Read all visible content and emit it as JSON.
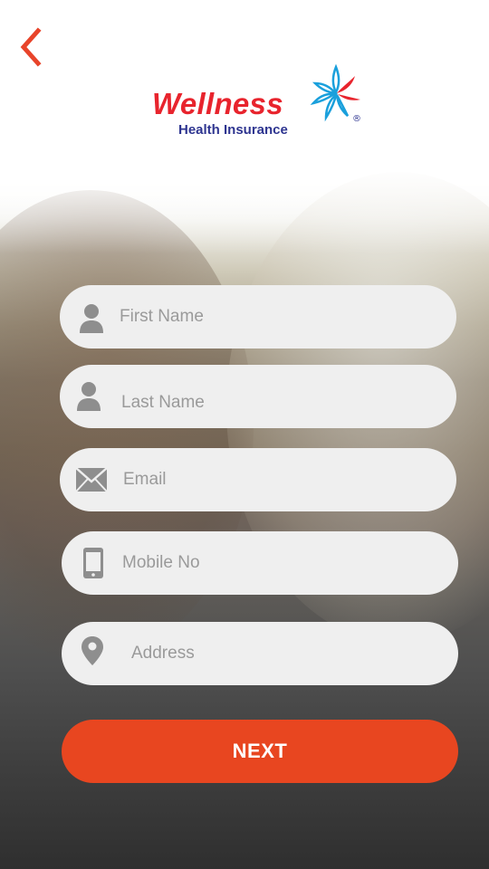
{
  "header": {
    "brand_name": "Wellness",
    "brand_sub": "Health Insurance",
    "registered_mark": "®"
  },
  "form": {
    "first_name": {
      "placeholder": "First Name",
      "value": "",
      "icon": "user-icon"
    },
    "last_name": {
      "placeholder": "Last Name",
      "value": "",
      "icon": "user-icon"
    },
    "email": {
      "placeholder": "Email",
      "value": "",
      "icon": "envelope-icon"
    },
    "mobile": {
      "placeholder": "Mobile No",
      "value": "",
      "icon": "mobile-phone-icon"
    },
    "address": {
      "placeholder": "Address",
      "value": "",
      "icon": "location-pin-icon"
    }
  },
  "actions": {
    "next_label": "NEXT"
  },
  "colors": {
    "accent": "#e84620",
    "back_arrow": "#e8442a",
    "brand_red": "#e8242d",
    "brand_blue": "#2e3590",
    "field_bg": "#efefef",
    "icon_gray": "#8e8e8e"
  }
}
